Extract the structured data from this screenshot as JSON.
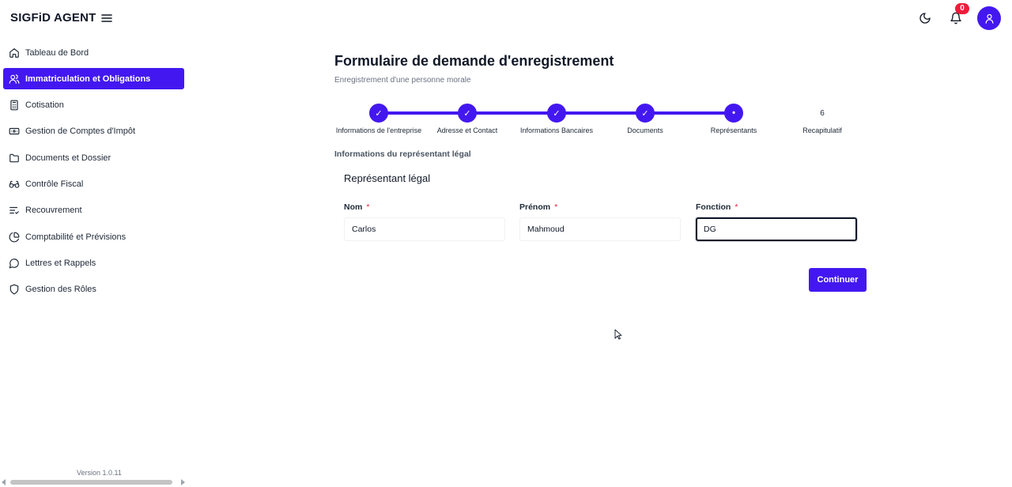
{
  "app": {
    "brand": "SIGFiD AGENT"
  },
  "header": {
    "notifications_count": "0",
    "colors": {
      "accent": "#4318f0",
      "badge": "#ef1c3a"
    }
  },
  "sidebar": {
    "items": [
      {
        "label": "Tableau de Bord",
        "icon": "home-icon",
        "active": false
      },
      {
        "label": "Immatriculation et Obligations",
        "icon": "users-icon",
        "active": true
      },
      {
        "label": "Cotisation",
        "icon": "calculator-icon",
        "active": false
      },
      {
        "label": "Gestion de Comptes d'Impôt",
        "icon": "banknote-icon",
        "active": false
      },
      {
        "label": "Documents et Dossier",
        "icon": "folder-icon",
        "active": false
      },
      {
        "label": "Contrôle Fiscal",
        "icon": "glasses-icon",
        "active": false
      },
      {
        "label": "Recouvrement",
        "icon": "list-check-icon",
        "active": false
      },
      {
        "label": "Comptabilité et Prévisions",
        "icon": "pie-chart-icon",
        "active": false
      },
      {
        "label": "Lettres et Rappels",
        "icon": "message-circle-icon",
        "active": false
      },
      {
        "label": "Gestion des Rôles",
        "icon": "shield-icon",
        "active": false
      }
    ],
    "version": "Version 1.0.11"
  },
  "main": {
    "title": "Formulaire de demande d'enregistrement",
    "subtitle": "Enregistrement d'une personne morale",
    "steps": [
      {
        "label": "Informations de l'entreprise",
        "status": "done",
        "mark": "✓"
      },
      {
        "label": "Adresse et Contact",
        "status": "done",
        "mark": "✓"
      },
      {
        "label": "Informations Bancaires",
        "status": "done",
        "mark": "✓"
      },
      {
        "label": "Documents",
        "status": "done",
        "mark": "✓"
      },
      {
        "label": "Représentants",
        "status": "current",
        "mark": "•"
      },
      {
        "label": "Recapitulatif",
        "status": "pending",
        "mark": "6"
      }
    ],
    "section_title": "Informations du représentant légal",
    "card_title": "Représentant légal",
    "fields": {
      "nom": {
        "label": "Nom",
        "required_mark": "*",
        "value": "Carlos"
      },
      "prenom": {
        "label": "Prénom",
        "required_mark": "*",
        "value": "Mahmoud"
      },
      "fonction": {
        "label": "Fonction",
        "required_mark": "*",
        "value": "DG"
      }
    },
    "continue_label": "Continuer"
  }
}
